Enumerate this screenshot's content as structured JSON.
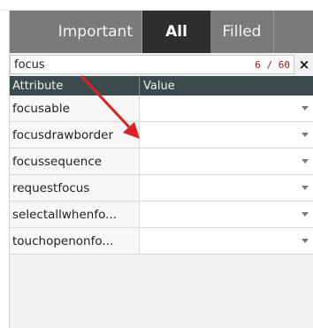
{
  "tabs": [
    {
      "label": "Important"
    },
    {
      "label": "All"
    },
    {
      "label": "Filled"
    }
  ],
  "search": {
    "value": "focus",
    "count": "6 / 60",
    "clear_icon": "×"
  },
  "table": {
    "headers": {
      "attribute": "Attribute",
      "value": "Value"
    },
    "rows": [
      {
        "attribute": "focusable"
      },
      {
        "attribute": "focusdrawborder"
      },
      {
        "attribute": "focussequence"
      },
      {
        "attribute": "requestfocus"
      },
      {
        "attribute": "selectallwhenfo..."
      },
      {
        "attribute": "touchopenonfo..."
      }
    ]
  },
  "colors": {
    "tab_active": "#2e2e2e",
    "tab_inactive": "#7a7a7a",
    "header_bg": "#3b4a4c",
    "count_text": "#bb1111",
    "annotation_arrow": "#e02020"
  }
}
